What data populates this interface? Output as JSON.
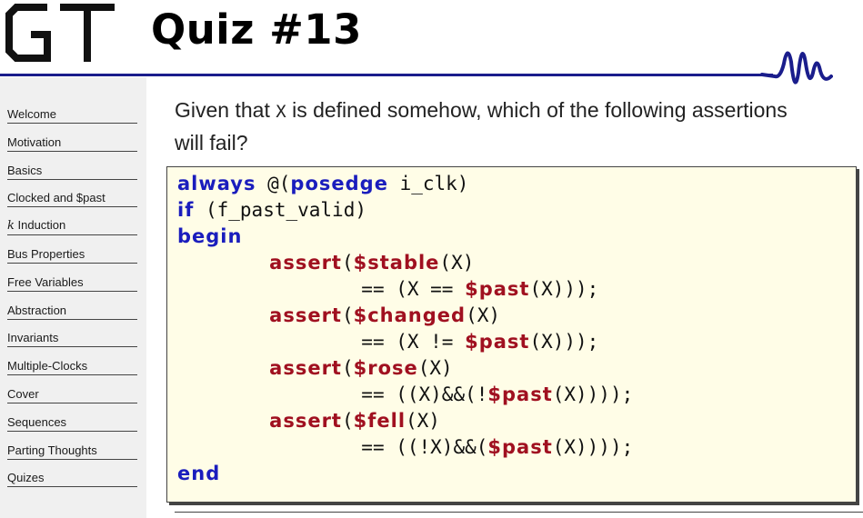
{
  "logo": {
    "text": "GT"
  },
  "slide": {
    "title": "Quiz #13"
  },
  "sidebar": {
    "items": [
      {
        "label": "Welcome"
      },
      {
        "label": "Motivation"
      },
      {
        "label": "Basics"
      },
      {
        "label": "Clocked and $past"
      },
      {
        "label": "k Induction"
      },
      {
        "label": "Bus Properties"
      },
      {
        "label": "Free Variables"
      },
      {
        "label": "Abstraction"
      },
      {
        "label": "Invariants"
      },
      {
        "label": "Multiple-Clocks"
      },
      {
        "label": "Cover"
      },
      {
        "label": "Sequences"
      },
      {
        "label": "Parting Thoughts"
      },
      {
        "label": "Quizes"
      }
    ]
  },
  "question": {
    "before": "Given that ",
    "code": "X",
    "after": " is defined somehow, which of the following assertions will fail?"
  },
  "code": {
    "always": "always",
    "at": " @(",
    "posedge": "posedge",
    "clk": " i_clk)",
    "if": "if",
    "cond": " (f_past_valid)",
    "begin": "begin",
    "indent": "        ",
    "indent2": "                ",
    "assert": "assert",
    "open": "(",
    "stable": "$stable",
    "changed": "$changed",
    "rose": "$rose",
    "fell": "$fell",
    "past": "$past",
    "argX": "(X)",
    "eq_stable": "== (X == ",
    "eq_changed": "== (X != ",
    "eq_rose": "== ((X)&&(!",
    "eq_fell": "== ((!X)&&(",
    "close3": "(X)));",
    "close4": "(X))));",
    "end": "end"
  }
}
